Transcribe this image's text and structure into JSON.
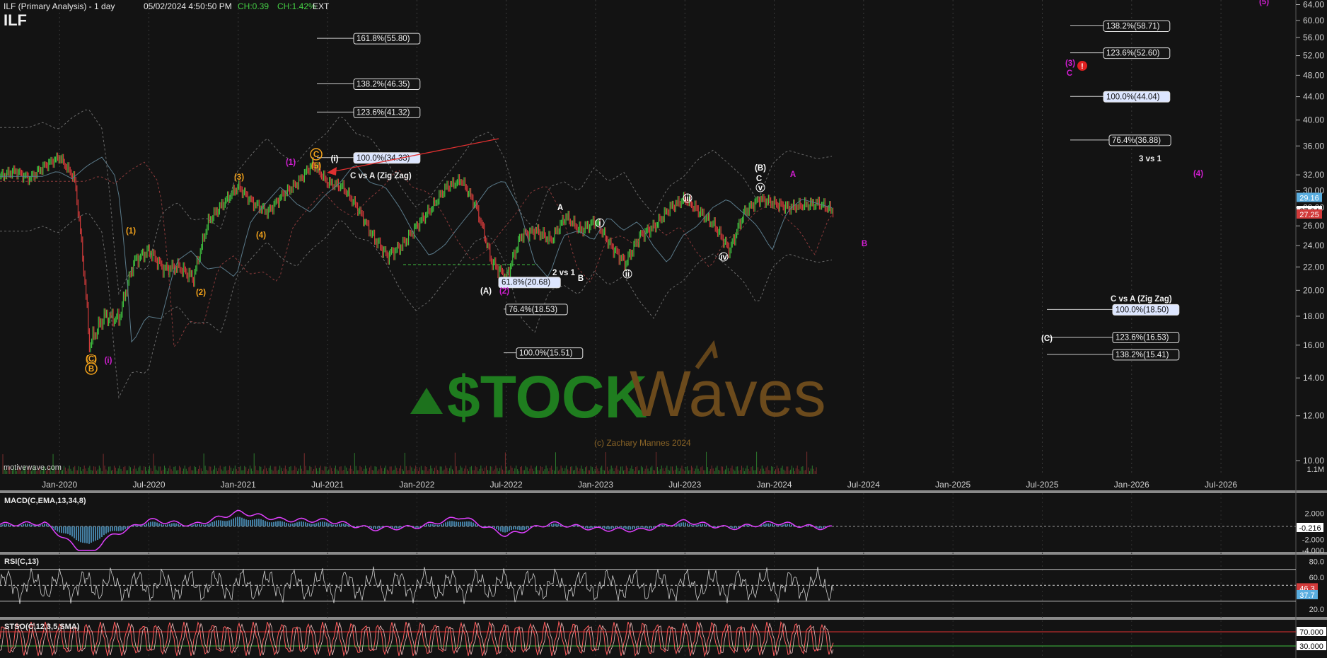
{
  "header": {
    "symbol": "ILF (Primary Analysis) - 1 day",
    "datetime": "05/02/2024 4:50:50 PM",
    "change": "CH:0.39",
    "change_pct": "CH:1.42%",
    "session": "EXT",
    "ticker": "ILF"
  },
  "watermark": {
    "source": "motivewave.com",
    "brand_left": "$TOCK",
    "brand_right": "Waves",
    "copyright": "(c) Zachary Mannes 2024"
  },
  "colors": {
    "background": "#131313",
    "up_candle": "#3fbf3f",
    "down_candle": "#d23a3a",
    "wave_orange": "#f4a31b",
    "wave_magenta": "#d21ed2",
    "wave_white": "#ffffff",
    "macd_line": "#e040ff",
    "macd_hist": "#5aaee0",
    "rsi_line": "#d0d0d0",
    "stoch_k": "#ff5c5c",
    "stoch_d": "#f0c0c0"
  },
  "chart_data": [
    {
      "type": "line",
      "title": "ILF (Primary Analysis) - 1 day",
      "xlabel": "",
      "ylabel": "",
      "y_scale": "log",
      "ylim": [
        9.5,
        66
      ],
      "x_ticks": [
        "Jan-2020",
        "Jul-2020",
        "Jan-2021",
        "Jul-2021",
        "Jan-2022",
        "Jul-2022",
        "Jan-2023",
        "Jul-2023",
        "Jan-2024",
        "Jul-2024",
        "Jan-2025",
        "Jul-2025",
        "Jan-2026",
        "Jul-2026"
      ],
      "y_ticks": [
        "64.00",
        "60.00",
        "56.00",
        "52.00",
        "48.00",
        "44.00",
        "40.00",
        "36.00",
        "32.00",
        "30.00",
        "28.00",
        "26.00",
        "24.00",
        "22.00",
        "20.00",
        "18.00",
        "16.00",
        "14.00",
        "12.00",
        "10.00"
      ],
      "price_labels": [
        "29.16",
        "27.64",
        "27.25"
      ],
      "volume_label": "1.1M",
      "series": [
        {
          "x": [
            "2019-09",
            "2019-10",
            "2019-11",
            "2019-12",
            "2020-01",
            "2020-02",
            "2020-03",
            "2020-04",
            "2020-05",
            "2020-06",
            "2020-07",
            "2020-08",
            "2020-09",
            "2020-10",
            "2020-11",
            "2020-12",
            "2021-01",
            "2021-02",
            "2021-03",
            "2021-04",
            "2021-05",
            "2021-06",
            "2021-07",
            "2021-08",
            "2021-09",
            "2021-10",
            "2021-11",
            "2021-12",
            "2022-01",
            "2022-02",
            "2022-03",
            "2022-04",
            "2022-05",
            "2022-06",
            "2022-07",
            "2022-08",
            "2022-09",
            "2022-10",
            "2022-11",
            "2022-12",
            "2023-01",
            "2023-02",
            "2023-03",
            "2023-04",
            "2023-05",
            "2023-06",
            "2023-07",
            "2023-08",
            "2023-09",
            "2023-10",
            "2023-11",
            "2023-12",
            "2024-01",
            "2024-02",
            "2024-03",
            "2024-04",
            "2024-05"
          ],
          "values": [
            31.8,
            32.5,
            31.5,
            33.2,
            34.4,
            31.5,
            16.0,
            18.0,
            17.8,
            22.5,
            23.5,
            21.8,
            22.0,
            21.0,
            26.5,
            28.5,
            30.5,
            28.5,
            27.5,
            29.5,
            31.0,
            33.5,
            31.0,
            30.5,
            28.0,
            25.0,
            23.0,
            24.0,
            26.0,
            28.0,
            30.5,
            31.3,
            28.0,
            22.5,
            21.0,
            25.0,
            25.5,
            24.5,
            27.0,
            25.5,
            26.5,
            24.0,
            22.3,
            25.0,
            26.0,
            28.0,
            29.0,
            27.5,
            26.0,
            23.5,
            27.5,
            29.0,
            28.5,
            28.0,
            28.3,
            28.5,
            27.6
          ]
        }
      ],
      "annotations": {
        "fib_labels": [
          "161.8%(55.80)",
          "138.2%(46.35)",
          "123.6%(41.32)",
          "100.0%(34.33)",
          "61.8%(20.68)",
          "76.4%(18.53)",
          "100.0%(15.51)",
          "138.2%(58.71)",
          "123.6%(52.60)",
          "100.0%(44.04)",
          "76.4%(36.88)",
          "100.0%(18.50)",
          "123.6%(16.53)",
          "138.2%(15.41)"
        ],
        "text_notes": [
          "C vs A (Zig Zag)",
          "2 vs 1",
          "3 vs 1",
          "C vs A (Zig Zag)"
        ],
        "wave_labels": [
          "(C)",
          "B",
          "(i)",
          "(1)",
          "(2)",
          "(3)",
          "(4)",
          "(5)",
          "C",
          "(i)",
          "(1)",
          "(A)",
          "(2)",
          "A",
          "B",
          "i",
          "ii",
          "iii",
          "iv",
          "v",
          "(B)",
          "C",
          "A",
          "B",
          "(3)",
          "C",
          "(4)",
          "(5)",
          "(C)"
        ]
      }
    },
    {
      "type": "line",
      "title": "MACD(C,EMA,13,34,8)",
      "y_ticks": [
        "2.000",
        "-2.000",
        "-4.000"
      ],
      "value_label": "-0.216",
      "series": [
        {
          "name": "MACD",
          "x": [
            "2019-09",
            "2019-12",
            "2020-03",
            "2020-04",
            "2020-07",
            "2020-10",
            "2021-01",
            "2021-04",
            "2021-07",
            "2021-10",
            "2022-01",
            "2022-04",
            "2022-07",
            "2022-10",
            "2023-01",
            "2023-04",
            "2023-07",
            "2023-10",
            "2024-01",
            "2024-04",
            "2024-05"
          ],
          "values": [
            0.3,
            0.5,
            -4.8,
            -2.0,
            1.0,
            0.2,
            2.2,
            1.0,
            0.9,
            -0.4,
            -0.1,
            1.5,
            -1.4,
            0.5,
            -0.4,
            -0.6,
            0.8,
            -0.3,
            0.6,
            -0.2,
            -0.216
          ]
        }
      ]
    },
    {
      "type": "line",
      "title": "RSI(C,13)",
      "y_ticks": [
        "80.0",
        "60.0",
        "20.0"
      ],
      "value_labels": [
        "46.3",
        "37.7"
      ],
      "levels": [
        70,
        50,
        30
      ]
    },
    {
      "type": "line",
      "title": "STSO(C,12,3,5,SMA)",
      "y_ticks": [
        "70.000",
        "30.000"
      ],
      "levels": [
        70,
        30
      ]
    }
  ]
}
